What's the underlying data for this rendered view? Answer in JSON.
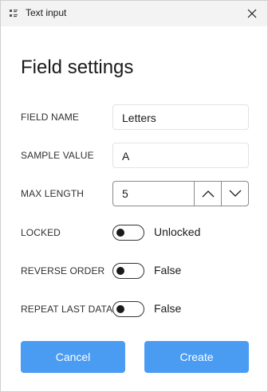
{
  "window": {
    "title": "Text input",
    "icon": "grid-icon",
    "close_icon": "close-icon"
  },
  "dialog": {
    "heading": "Field settings",
    "field_name": {
      "label": "FIELD NAME",
      "value": "Letters"
    },
    "sample_value": {
      "label": "SAMPLE VALUE",
      "value": "A"
    },
    "max_length": {
      "label": "MAX LENGTH",
      "value": "5",
      "up_icon": "chevron-up-icon",
      "down_icon": "chevron-down-icon"
    },
    "locked": {
      "label": "LOCKED",
      "state": "Unlocked",
      "on": false
    },
    "reverse_order": {
      "label": "REVERSE ORDER",
      "state": "False",
      "on": false
    },
    "repeat_last_data": {
      "label": "REPEAT LAST DATA",
      "state": "False",
      "on": false
    },
    "cancel_label": "Cancel",
    "create_label": "Create",
    "accent_color": "#4a9cf3"
  }
}
